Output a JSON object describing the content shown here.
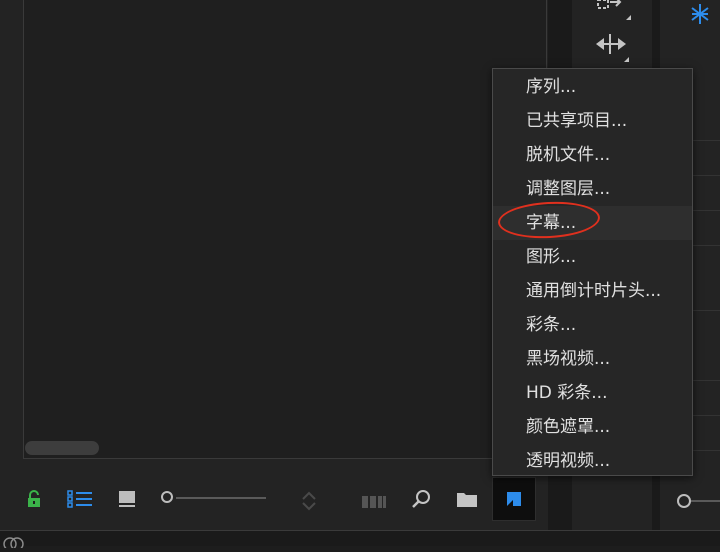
{
  "menu": {
    "items": [
      {
        "label": "序列..."
      },
      {
        "label": "已共享项目..."
      },
      {
        "label": "脱机文件..."
      },
      {
        "label": "调整图层..."
      },
      {
        "label": "字幕..."
      },
      {
        "label": "图形..."
      },
      {
        "label": "通用倒计时片头..."
      },
      {
        "label": "彩条..."
      },
      {
        "label": "黑场视频..."
      },
      {
        "label": "HD 彩条..."
      },
      {
        "label": "颜色遮罩..."
      },
      {
        "label": "透明视频..."
      }
    ],
    "highlighted_index": 4
  },
  "toolbar": {
    "icons": [
      "lock-open-icon",
      "list-view-icon",
      "icon-view-icon",
      "zoom-slider",
      "sort-icon",
      "automate-to-sequence-icon",
      "find-icon",
      "new-bin-icon",
      "new-item-icon",
      "trash-icon"
    ]
  },
  "colors": {
    "accent_blue": "#2d8ceb",
    "lock_green": "#3bb34a",
    "annotation_red": "#e0301e"
  }
}
